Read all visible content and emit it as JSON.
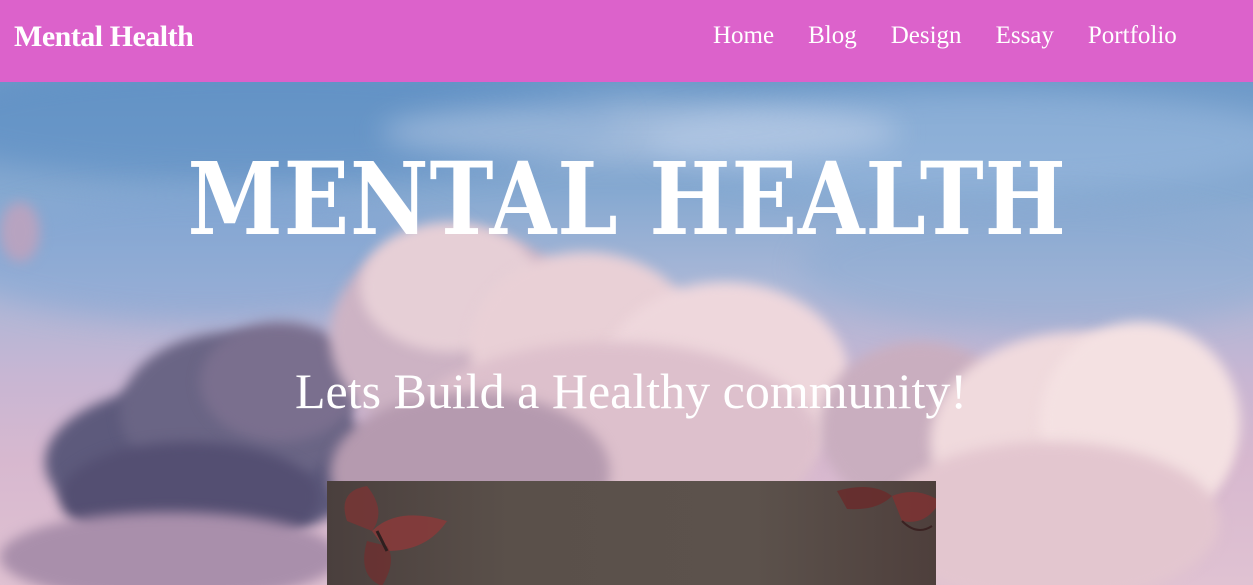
{
  "navbar": {
    "brand": "Mental Health",
    "background": "#dc62cb",
    "links": [
      "Home",
      "Blog",
      "Design",
      "Essay",
      "Portfolio"
    ]
  },
  "hero": {
    "title": "MENTAL HEALTH",
    "subtitle": "Lets Build a Healthy community!"
  }
}
